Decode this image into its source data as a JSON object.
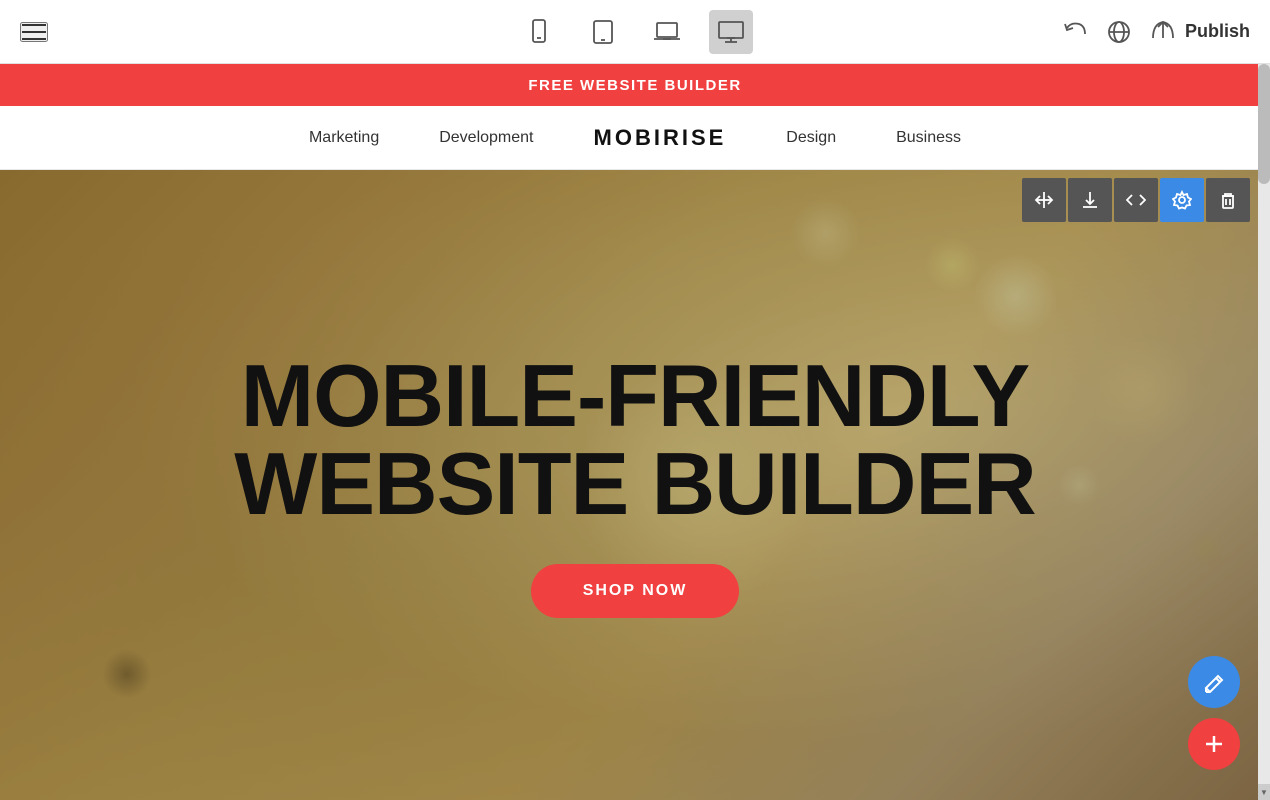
{
  "toolbar": {
    "publish_label": "Publish",
    "devices": [
      {
        "id": "mobile",
        "label": "Mobile view"
      },
      {
        "id": "tablet",
        "label": "Tablet view"
      },
      {
        "id": "laptop",
        "label": "Laptop view"
      },
      {
        "id": "desktop",
        "label": "Desktop view",
        "active": true
      }
    ]
  },
  "promo_banner": {
    "text": "FREE WEBSITE BUILDER"
  },
  "site_nav": {
    "logo": "MOBIRISE",
    "items": [
      {
        "label": "Marketing"
      },
      {
        "label": "Development"
      },
      {
        "label": "Design"
      },
      {
        "label": "Business"
      }
    ]
  },
  "hero": {
    "title_line1": "MOBILE-FRIENDLY",
    "title_line2": "WEBSITE BUILDER",
    "cta_label": "SHOP NOW"
  },
  "section_tools": [
    {
      "id": "move",
      "label": "Move section"
    },
    {
      "id": "download",
      "label": "Download section"
    },
    {
      "id": "code",
      "label": "Edit code"
    },
    {
      "id": "settings",
      "label": "Section settings",
      "active": true
    },
    {
      "id": "delete",
      "label": "Delete section"
    }
  ],
  "float_buttons": [
    {
      "id": "edit",
      "label": "Edit",
      "color": "blue"
    },
    {
      "id": "add",
      "label": "Add block",
      "color": "red"
    }
  ]
}
